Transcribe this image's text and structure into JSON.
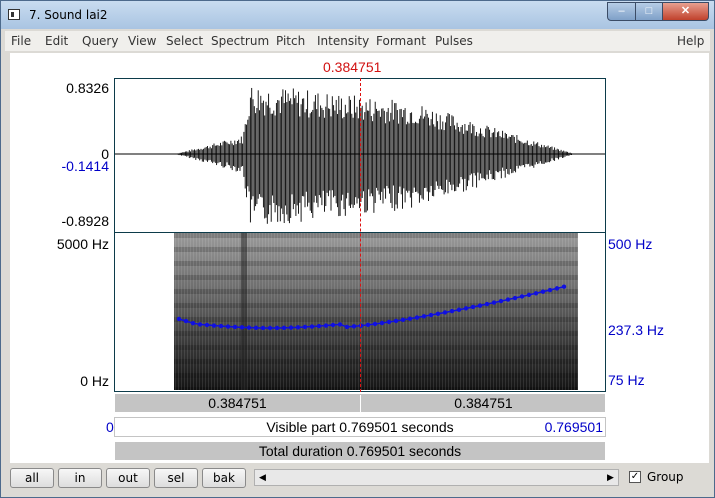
{
  "window": {
    "title": "7. Sound lai2",
    "min_glyph": "–",
    "max_glyph": "□",
    "close_glyph": "✕"
  },
  "menu": [
    "File",
    "Edit",
    "Query",
    "View",
    "Select",
    "Spectrum",
    "Pitch",
    "Intensity",
    "Formant",
    "Pulses"
  ],
  "help": "Help",
  "cursor_time": "0.384751",
  "waveform": {
    "ymax": "0.8326",
    "zero": "0",
    "cursor_value": "-0.1414",
    "ymin": "-0.8928"
  },
  "spectrogram": {
    "fmax": "5000 Hz",
    "fmin": "0 Hz"
  },
  "pitch_axis": {
    "top": "500 Hz",
    "cursor": "237.3 Hz",
    "bottom": "75 Hz"
  },
  "time_bar": {
    "left": "0.384751",
    "right": "0.384751"
  },
  "visible_bar": {
    "start": "0",
    "label": "Visible part 0.769501 seconds",
    "end": "0.769501"
  },
  "total_bar": {
    "label": "Total duration 0.769501 seconds"
  },
  "buttons": [
    "all",
    "in",
    "out",
    "sel",
    "bak"
  ],
  "group": {
    "label": "Group",
    "checked": true
  },
  "colors": {
    "cursor": "#d11111",
    "pitch": "#1010e0",
    "axis_blue": "#0000c8"
  }
}
